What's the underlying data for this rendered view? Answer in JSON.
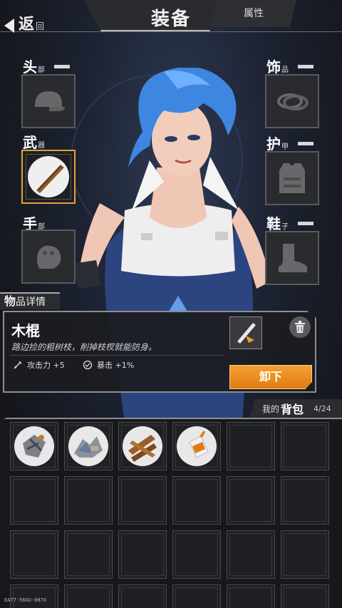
{
  "header": {
    "back_big": "返",
    "back_small": "回",
    "title": "装备",
    "attr_tab": "属性"
  },
  "slots": {
    "head": {
      "big": "头",
      "small": "部",
      "icon": "cap-icon"
    },
    "weapon": {
      "big": "武",
      "small": "器",
      "icon": "wooden-stick-icon"
    },
    "hand": {
      "big": "手",
      "small": "部",
      "icon": "glove-icon"
    },
    "accessory": {
      "big": "饰",
      "small": "品",
      "icon": "ring-icon"
    },
    "armor": {
      "big": "护",
      "small": "甲",
      "icon": "vest-icon"
    },
    "shoes": {
      "big": "鞋",
      "small": "子",
      "icon": "boot-icon"
    }
  },
  "detail": {
    "tab_big": "物",
    "tab_small": "品详情",
    "name": "木棍",
    "description": "路边捡的粗树枝，削掉枝杈就能防身。",
    "stat_attack": "攻击力 +5",
    "stat_crit": "暴击 +1%",
    "unequip": "卸下"
  },
  "bag": {
    "tab_small": "我的",
    "tab_big": "背包",
    "count": "4/24",
    "items": [
      {
        "icon": "scrap-metal-icon"
      },
      {
        "icon": "debris-pile-icon"
      },
      {
        "icon": "wood-planks-icon"
      },
      {
        "icon": "glue-bottle-icon"
      }
    ],
    "empty_cells": 20
  },
  "serial": "EA77-56GU-087X",
  "colors": {
    "accent": "#e3a235",
    "hair": "#3f86e0",
    "overalls": "#2c4480"
  }
}
